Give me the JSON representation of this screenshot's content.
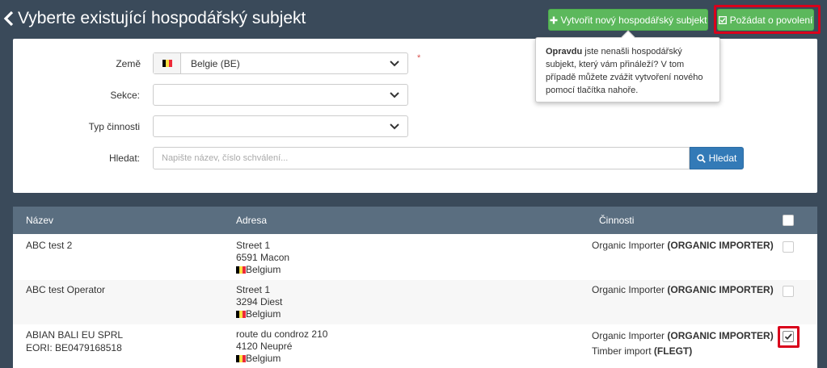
{
  "header": {
    "title": "Vyberte existující hospodářský subjekt",
    "create_button": "Vytvořit nový hospodářský subjekt",
    "request_button": "Požádat o povolení",
    "accent": "#5cb85c",
    "highlight_color": "#d9001b"
  },
  "filters": {
    "country_label": "Země",
    "country_value": "Belgie (BE)",
    "section_label": "Sekce:",
    "activity_label": "Typ činnosti",
    "search_label": "Hledat:",
    "search_placeholder": "Napište název, číslo schválení...",
    "search_button": "Hledat",
    "required_mark": "*"
  },
  "tooltip": {
    "bold": "Opravdu",
    "text": " jste nenašli hospodářský subjekt, který vám přináleží? V tom případě můžete zvážit vytvoření nového pomocí tlačítka nahoře."
  },
  "table": {
    "headers": [
      "Název",
      "Adresa",
      "Činnosti"
    ],
    "rows": [
      {
        "name": "ABC test 2",
        "eori": "",
        "street": "Street 1",
        "city": "6591 Macon",
        "country": "Belgium",
        "activities": [
          {
            "label": "Organic Importer ",
            "code": "(ORGANIC IMPORTER)"
          }
        ],
        "checked": false
      },
      {
        "name": "ABC test Operator",
        "eori": "",
        "street": "Street 1",
        "city": "3294 Diest",
        "country": "Belgium",
        "activities": [
          {
            "label": "Organic Importer ",
            "code": "(ORGANIC IMPORTER)"
          }
        ],
        "checked": false
      },
      {
        "name": "ABIAN BALI EU SPRL",
        "eori": "EORI: BE0479168518",
        "street": "route du condroz 210",
        "city": "4120 Neupré",
        "country": "Belgium",
        "activities": [
          {
            "label": "Organic Importer ",
            "code": "(ORGANIC IMPORTER)"
          },
          {
            "label": "Timber import ",
            "code": "(FLEGT)"
          }
        ],
        "checked": true
      }
    ]
  },
  "icons": {
    "back": "chevron-left-icon",
    "plus": "plus-icon",
    "check_square": "check-square-icon",
    "search": "search-icon",
    "dropdown": "chevron-down-icon",
    "flag": "belgium-flag-icon"
  }
}
